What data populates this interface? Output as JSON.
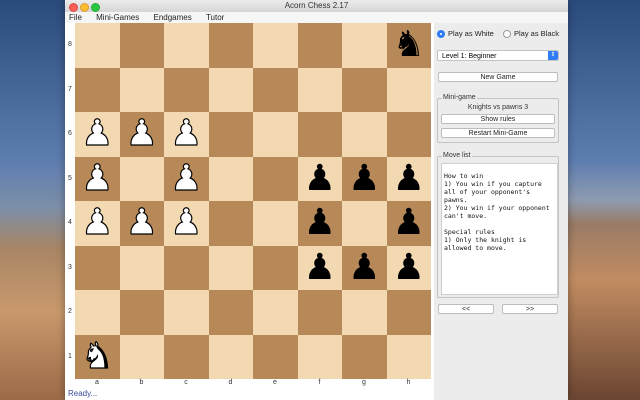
{
  "window": {
    "title": "Acorn Chess 2.17"
  },
  "menu": [
    "File",
    "Mini-Games",
    "Endgames",
    "Tutor"
  ],
  "board": {
    "ranks": [
      "8",
      "7",
      "6",
      "5",
      "4",
      "3",
      "2",
      "1"
    ],
    "files": [
      "a",
      "b",
      "c",
      "d",
      "e",
      "f",
      "g",
      "h"
    ],
    "pieces": {
      "h8": {
        "type": "knight",
        "color": "black"
      },
      "a6": {
        "type": "pawn",
        "color": "white"
      },
      "b6": {
        "type": "pawn",
        "color": "white"
      },
      "c6": {
        "type": "pawn",
        "color": "white"
      },
      "a5": {
        "type": "pawn",
        "color": "white"
      },
      "c5": {
        "type": "pawn",
        "color": "white"
      },
      "f5": {
        "type": "pawn",
        "color": "black"
      },
      "g5": {
        "type": "pawn",
        "color": "black"
      },
      "h5": {
        "type": "pawn",
        "color": "black"
      },
      "a4": {
        "type": "pawn",
        "color": "white"
      },
      "b4": {
        "type": "pawn",
        "color": "white"
      },
      "c4": {
        "type": "pawn",
        "color": "white"
      },
      "f4": {
        "type": "pawn",
        "color": "black"
      },
      "h4": {
        "type": "pawn",
        "color": "black"
      },
      "f3": {
        "type": "pawn",
        "color": "black"
      },
      "g3": {
        "type": "pawn",
        "color": "black"
      },
      "h3": {
        "type": "pawn",
        "color": "black"
      },
      "a1": {
        "type": "knight",
        "color": "white"
      }
    }
  },
  "panel": {
    "play_white": "Play as White",
    "play_black": "Play as Black",
    "level": "Level 1: Beginner",
    "new_game": "New Game",
    "minigame_title": "Mini-game",
    "minigame_name": "Knights vs pawns 3",
    "show_rules": "Show rules",
    "restart": "Restart Mini-Game",
    "movelist_title": "Move list",
    "movelist_text": "How to win\n1) You win if you capture all of your opponent's pawns.\n2) You win if your opponent can't move.\n\nSpecial rules\n1) Only the knight is allowed to move.",
    "prev": "<<",
    "next": ">>"
  },
  "status": "Ready..."
}
